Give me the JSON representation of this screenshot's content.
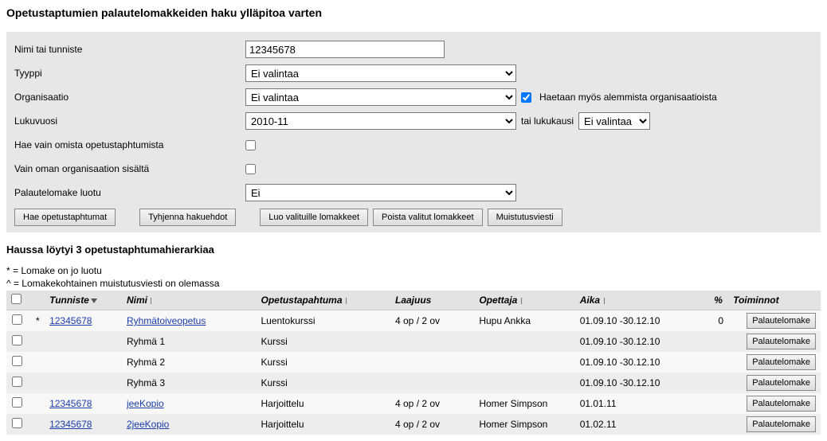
{
  "page_title": "Opetustaptumien palautelomakkeiden haku ylläpitoa varten",
  "form": {
    "labels": {
      "nimi": "Nimi tai tunniste",
      "tyyppi": "Tyyppi",
      "organisaatio": "Organisaatio",
      "lukuvuosi": "Lukuvuosi",
      "hae_omista": "Hae vain omista opetustaphtumista",
      "vain_oman": "Vain oman organisaation sisältä",
      "palaute_luotu": "Palautelomake luotu"
    },
    "values": {
      "nimi": "12345678",
      "tyyppi": "Ei valintaa",
      "organisaatio": "Ei valintaa",
      "lukuvuosi": "2010-11",
      "lukukausi": "Ei valintaa",
      "palaute_luotu": "Ei"
    },
    "extra": {
      "haetaan_alemmista": "Haetaan myös alemmista organisaatioista",
      "tai_lukukausi": "tai lukukausi"
    }
  },
  "buttons": {
    "hae": "Hae opetustaphtumat",
    "tyhjenna": "Tyhjenna hakuehdot",
    "luo": "Luo valituille lomakkeet",
    "poista": "Poista valitut lomakkeet",
    "muistutus": "Muistutusviesti",
    "palautelomake": "Palautelomake"
  },
  "results_title": "Haussa löytyi 3 opetustaphtumahierarkiaa",
  "legend": {
    "star": "* = Lomake on jo luotu",
    "caret": "^ = Lomakekohtainen muistutusviesti on olemassa"
  },
  "headers": {
    "tunniste": "Tunniste",
    "nimi": "Nimi",
    "opetustapahtuma": "Opetustapahtuma",
    "laajuus": "Laajuus",
    "opettaja": "Opettaja",
    "aika": "Aika",
    "pct": "%",
    "toiminnot": "Toiminnot"
  },
  "rows": [
    {
      "mark": "*",
      "tunniste": "12345678",
      "tunniste_link": true,
      "nimi": "Ryhmätoiveopetus",
      "nimi_link": true,
      "op": "Luentokurssi",
      "laajuus": "4 op / 2 ov",
      "opettaja": "Hupu Ankka",
      "aika": "01.09.10 -30.12.10",
      "pct": "0",
      "toim": true
    },
    {
      "mark": "",
      "tunniste": "",
      "tunniste_link": false,
      "nimi": "Ryhmä 1",
      "nimi_link": false,
      "op": "Kurssi",
      "laajuus": "",
      "opettaja": "",
      "aika": "01.09.10 -30.12.10",
      "pct": "",
      "toim": true
    },
    {
      "mark": "",
      "tunniste": "",
      "tunniste_link": false,
      "nimi": "Ryhmä 2",
      "nimi_link": false,
      "op": "Kurssi",
      "laajuus": "",
      "opettaja": "",
      "aika": "01.09.10 -30.12.10",
      "pct": "",
      "toim": true
    },
    {
      "mark": "",
      "tunniste": "",
      "tunniste_link": false,
      "nimi": "Ryhmä 3",
      "nimi_link": false,
      "op": "Kurssi",
      "laajuus": "",
      "opettaja": "",
      "aika": "01.09.10 -30.12.10",
      "pct": "",
      "toim": true
    },
    {
      "mark": "",
      "tunniste": "12345678",
      "tunniste_link": true,
      "nimi": "jeeKopio",
      "nimi_link": true,
      "op": "Harjoittelu",
      "laajuus": "4 op / 2 ov",
      "opettaja": "Homer Simpson",
      "aika": "01.01.11",
      "pct": "",
      "toim": true
    },
    {
      "mark": "",
      "tunniste": "12345678",
      "tunniste_link": true,
      "nimi": "2jeeKopio",
      "nimi_link": true,
      "op": "Harjoittelu",
      "laajuus": "4 op / 2 ov",
      "opettaja": "Homer Simpson",
      "aika": "01.02.11",
      "pct": "",
      "toim": true
    }
  ]
}
